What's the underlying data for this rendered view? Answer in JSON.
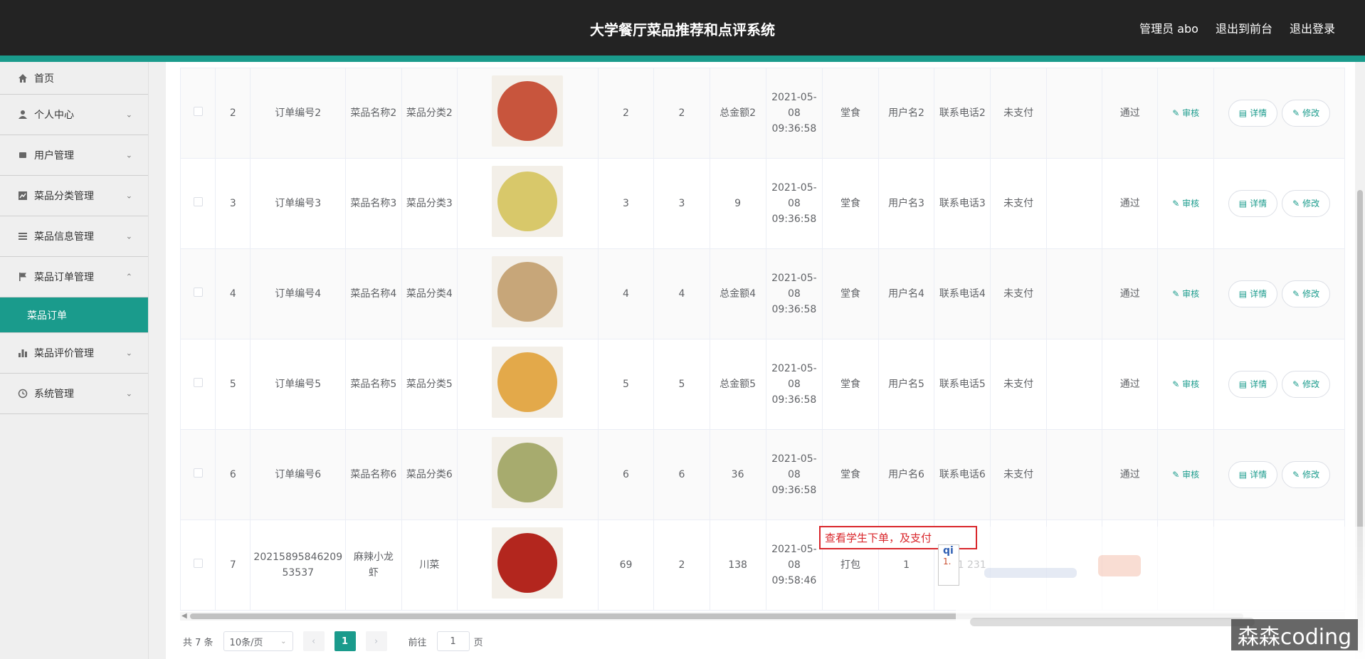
{
  "header": {
    "title": "大学餐厅菜品推荐和点评系统",
    "admin_label": "管理员 abo",
    "to_front": "退出到前台",
    "logout": "退出登录"
  },
  "sidebar": {
    "items": [
      {
        "label": "首页",
        "icon": "home-icon"
      },
      {
        "label": "个人中心",
        "icon": "user-icon"
      },
      {
        "label": "用户管理",
        "icon": "user-group-icon"
      },
      {
        "label": "菜品分类管理",
        "icon": "chart-icon"
      },
      {
        "label": "菜品信息管理",
        "icon": "list-icon"
      },
      {
        "label": "菜品订单管理",
        "icon": "flag-icon"
      },
      {
        "label": "菜品评价管理",
        "icon": "bar-icon"
      },
      {
        "label": "系统管理",
        "icon": "clock-icon"
      }
    ],
    "active_sub": "菜品订单"
  },
  "table": {
    "rows": [
      {
        "idx": "2",
        "order": "订单编号2",
        "name": "菜品名称2",
        "cat": "菜品分类2",
        "price": "2",
        "qty": "2",
        "total": "总金额2",
        "time": "2021-05-08 09:36:58",
        "type": "堂食",
        "user": "用户名2",
        "phone": "联系电话2",
        "pay": "未支付",
        "status": "通过",
        "audit": "审核",
        "detail": "详情",
        "edit": "修改",
        "food_color": "#c8553d"
      },
      {
        "idx": "3",
        "order": "订单编号3",
        "name": "菜品名称3",
        "cat": "菜品分类3",
        "price": "3",
        "qty": "3",
        "total": "9",
        "time": "2021-05-08 09:36:58",
        "type": "堂食",
        "user": "用户名3",
        "phone": "联系电话3",
        "pay": "未支付",
        "status": "通过",
        "audit": "审核",
        "detail": "详情",
        "edit": "修改",
        "food_color": "#d8c86a"
      },
      {
        "idx": "4",
        "order": "订单编号4",
        "name": "菜品名称4",
        "cat": "菜品分类4",
        "price": "4",
        "qty": "4",
        "total": "总金额4",
        "time": "2021-05-08 09:36:58",
        "type": "堂食",
        "user": "用户名4",
        "phone": "联系电话4",
        "pay": "未支付",
        "status": "通过",
        "audit": "审核",
        "detail": "详情",
        "edit": "修改",
        "food_color": "#c7a679"
      },
      {
        "idx": "5",
        "order": "订单编号5",
        "name": "菜品名称5",
        "cat": "菜品分类5",
        "price": "5",
        "qty": "5",
        "total": "总金额5",
        "time": "2021-05-08 09:36:58",
        "type": "堂食",
        "user": "用户名5",
        "phone": "联系电话5",
        "pay": "未支付",
        "status": "通过",
        "audit": "审核",
        "detail": "详情",
        "edit": "修改",
        "food_color": "#e3a94a"
      },
      {
        "idx": "6",
        "order": "订单编号6",
        "name": "菜品名称6",
        "cat": "菜品分类6",
        "price": "6",
        "qty": "6",
        "total": "36",
        "time": "2021-05-08 09:36:58",
        "type": "堂食",
        "user": "用户名6",
        "phone": "联系电话6",
        "pay": "未支付",
        "status": "通过",
        "audit": "审核",
        "detail": "详情",
        "edit": "修改",
        "food_color": "#a7ab6e"
      },
      {
        "idx": "7",
        "order": "20215895846209 53537",
        "name": "麻辣小龙虾",
        "cat": "川菜",
        "price": "69",
        "qty": "2",
        "total": "138",
        "time": "2021-05-08 09:58:46",
        "type": "打包",
        "user": "1",
        "phone": "1231 231",
        "pay": "",
        "status": "",
        "audit": "",
        "detail": "",
        "edit": "",
        "food_color": "#b3261e"
      }
    ]
  },
  "pager": {
    "total": "共 7 条",
    "page_size": "10条/页",
    "current": "1",
    "goto_prefix": "前往",
    "goto_value": "1",
    "goto_suffix": "页"
  },
  "overlay": {
    "callout": "查看学生下单，及支付",
    "tip_q": "qi",
    "tip_n": "1.",
    "watermark": "森森coding"
  }
}
